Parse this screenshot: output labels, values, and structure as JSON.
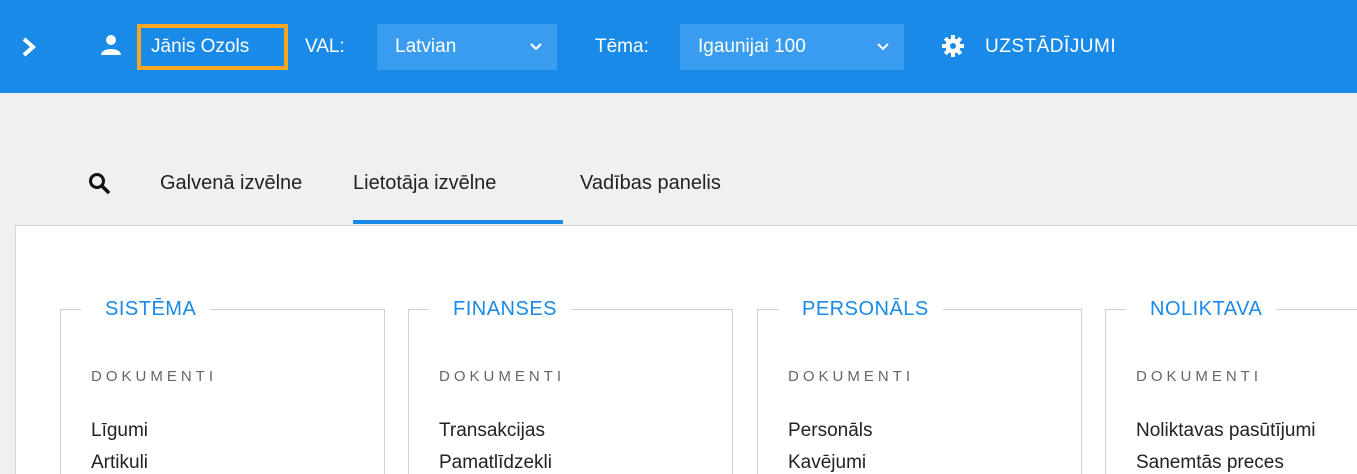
{
  "header": {
    "user_name": "Jānis Ozols",
    "language_label": "VAL:",
    "language_value": "Latvian",
    "theme_label": "Tēma:",
    "theme_value": "Igaunijai 100",
    "settings_label": "UZSTĀDĪJUMI",
    "icons": [
      "chevron-right-icon",
      "user-icon",
      "chevron-down-icon",
      "gear-icon"
    ],
    "colors": {
      "bar": "#1a8ae8",
      "select": "#3a9cee",
      "highlight": "#f5a623"
    }
  },
  "tabs": [
    {
      "label": "Galvenā izvēlne",
      "active": false
    },
    {
      "label": "Lietotāja izvēlne",
      "active": true
    },
    {
      "label": "Vadības panelis",
      "active": false
    }
  ],
  "modules": [
    {
      "title": "SISTĒMA",
      "section": "DOKUMENTI",
      "links": [
        "Līgumi",
        "Artikuli"
      ]
    },
    {
      "title": "FINANSES",
      "section": "DOKUMENTI",
      "links": [
        "Transakcijas",
        "Pamatlīdzekli"
      ]
    },
    {
      "title": "PERSONĀLS",
      "section": "DOKUMENTI",
      "links": [
        "Personāls",
        "Kavējumi"
      ]
    },
    {
      "title": "NOLIKTAVA",
      "section": "DOKUMENTI",
      "links": [
        "Noliktavas pasūtījumi",
        "Sanemtās preces"
      ]
    }
  ]
}
